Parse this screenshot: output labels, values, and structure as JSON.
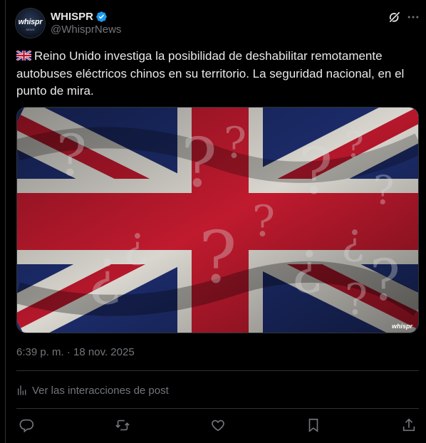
{
  "account": {
    "name": "WHISPR",
    "handle": "@WhisprNews",
    "avatar_text": "whispr",
    "avatar_subtext": "NEWS",
    "verified": true
  },
  "tweet": {
    "flag_emoji": "uk-flag",
    "text": "Reino Unido investiga la posibilidad de deshabilitar remotamente autobuses eléctricos chinos en su territorio. La seguridad nacional, en el punto de mira.",
    "media_alt": "Bandera del Reino Unido con signos de interrogación",
    "media_watermark": "whispr",
    "timestamp": "6:39 p. m. · 18 nov. 2025"
  },
  "interactions_link": "Ver las interacciones de post",
  "actions": [
    {
      "name": "reply",
      "icon": "reply-icon"
    },
    {
      "name": "repost",
      "icon": "repost-icon"
    },
    {
      "name": "like",
      "icon": "heart-icon"
    },
    {
      "name": "bookmark",
      "icon": "bookmark-icon"
    },
    {
      "name": "share",
      "icon": "share-icon"
    }
  ],
  "colors": {
    "background": "#000000",
    "text": "#e7e9ea",
    "muted": "#71767b",
    "border": "#2f3336",
    "verified": "#1d9bf0"
  }
}
